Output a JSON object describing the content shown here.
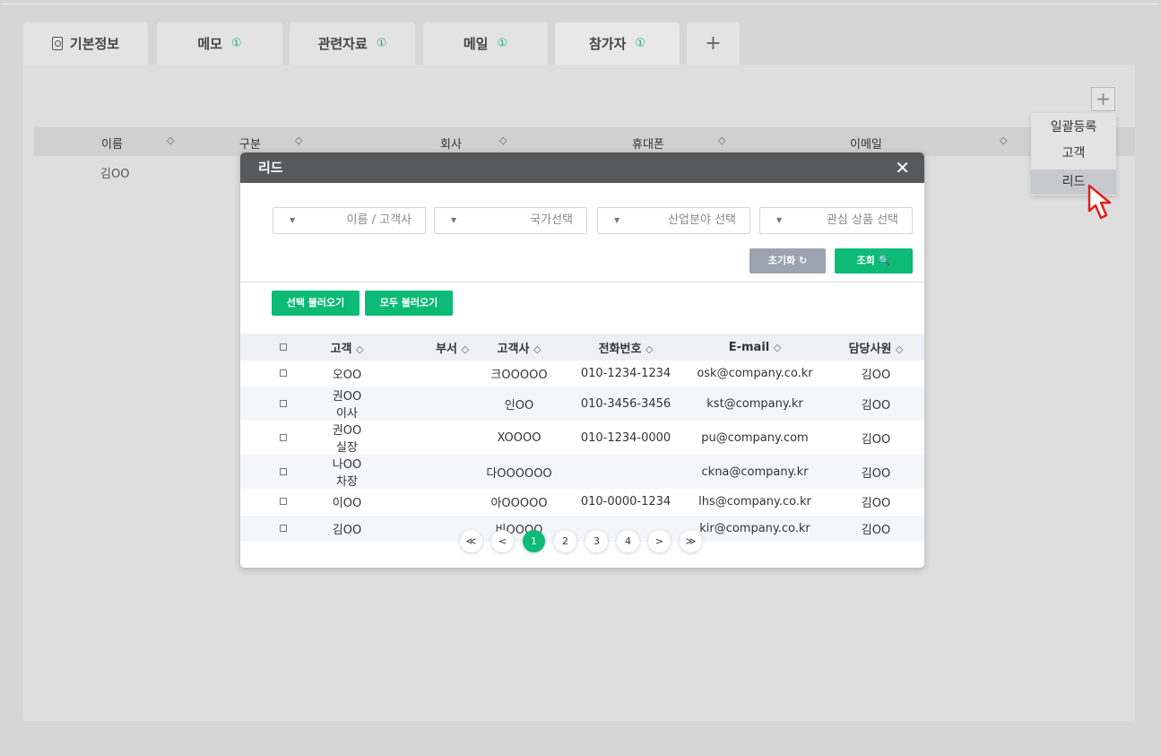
{
  "tabs": [
    {
      "label": "기본정보",
      "badge": ""
    },
    {
      "label": "메모",
      "badge": "①"
    },
    {
      "label": "관련자료",
      "badge": "①"
    },
    {
      "label": "메일",
      "badge": "①"
    },
    {
      "label": "참가자",
      "badge": "①"
    }
  ],
  "add_tab_label": "+",
  "panel": {
    "add_label": "+",
    "headers": [
      "이름",
      "구분",
      "회사",
      "휴대폰",
      "이메일"
    ],
    "row_name": "김OO",
    "sort_icon": "◇"
  },
  "dropdown": {
    "items": [
      "일괄등록",
      "고객",
      "리드"
    ]
  },
  "modal": {
    "title": "리드",
    "close": "✕",
    "filters": [
      "이름 / 고객사",
      "국가선택",
      "산업분야 선택",
      "관심 상품 선택"
    ],
    "reset_label": "초기화 ↻",
    "search_label": "조회 🔍",
    "load_selected": "선택 불러오기",
    "load_all": "모두 불러오기",
    "columns": [
      "고객",
      "부서",
      "고객사",
      "전화번호",
      "E-mail",
      "담당사원"
    ],
    "rows": [
      {
        "customer": "오OO",
        "dept": "",
        "company": "크OOOOO",
        "phone": "010-1234-1234",
        "email": "osk@company.co.kr",
        "owner": "김OO"
      },
      {
        "customer": "권OO 이사",
        "dept": "",
        "company": "인OO",
        "phone": "010-3456-3456",
        "email": "kst@company.kr",
        "owner": "김OO"
      },
      {
        "customer": "권OO 실장",
        "dept": "",
        "company": "XOOOO",
        "phone": "010-1234-0000",
        "email": "pu@company.com",
        "owner": "김OO"
      },
      {
        "customer": "나OO 차장",
        "dept": "",
        "company": "다OOOOOO",
        "phone": "",
        "email": "ckna@company.kr",
        "owner": "김OO"
      },
      {
        "customer": "이OO",
        "dept": "",
        "company": "아OOOOO",
        "phone": "010-0000-1234",
        "email": "lhs@company.co.kr",
        "owner": "김OO"
      },
      {
        "customer": "김OO",
        "dept": "",
        "company": "비OOOO",
        "phone": "",
        "email": "kir@company.co.kr",
        "owner": "김OO"
      }
    ],
    "pager": [
      "≪",
      "<",
      "1",
      "2",
      "3",
      "4",
      ">",
      "≫"
    ],
    "current_page": "1"
  },
  "colors": {
    "accent": "#0dba76",
    "badge": "#2aae6c",
    "modal_header": "#58595b"
  }
}
